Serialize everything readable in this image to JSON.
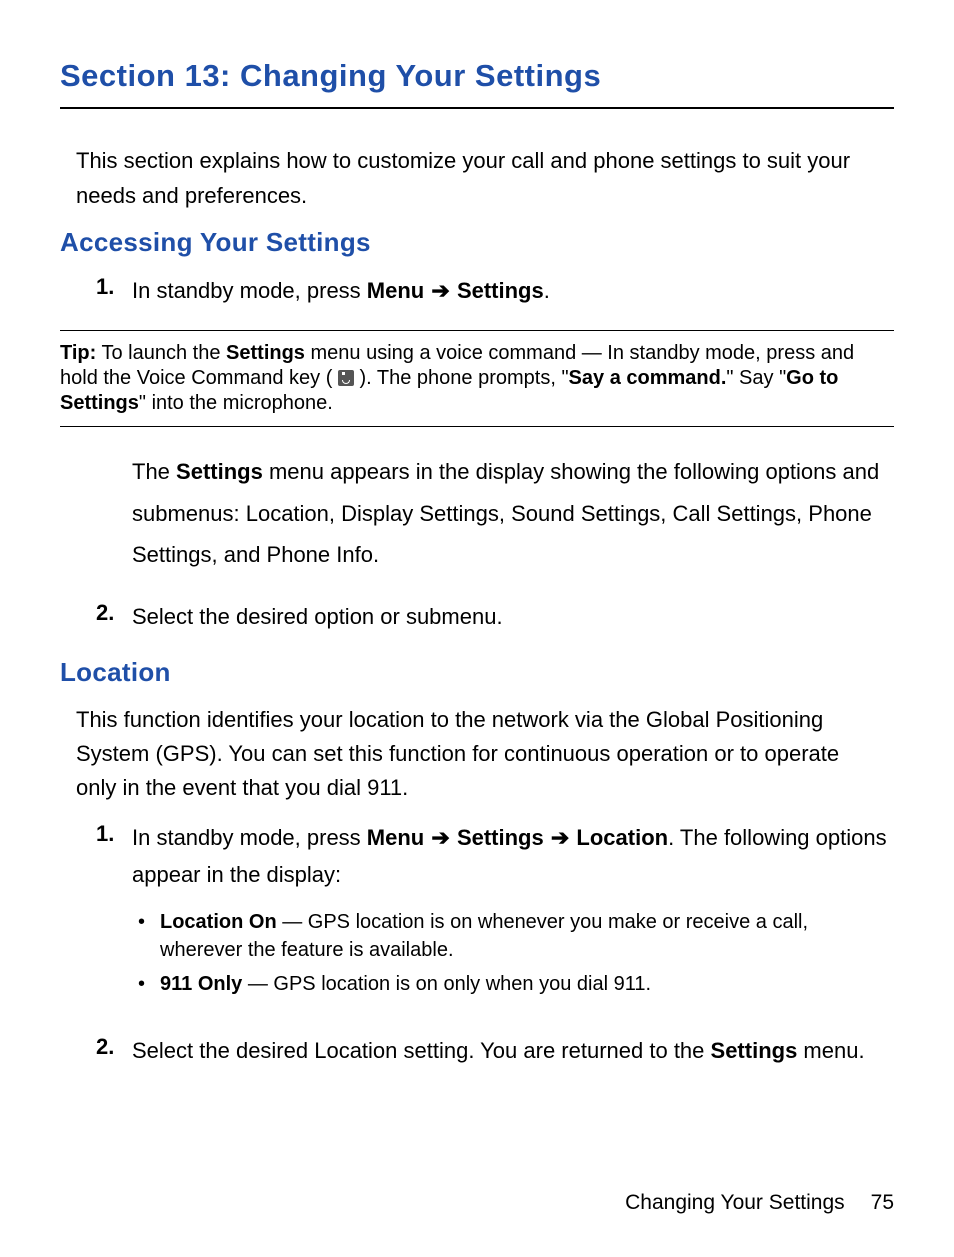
{
  "section_title": "Section 13: Changing Your Settings",
  "intro": "This section explains how to customize your call and phone settings to suit your needs and preferences.",
  "accessing": {
    "heading": "Accessing Your Settings",
    "steps": [
      {
        "num": "1.",
        "prefix": "In standby mode, press ",
        "menu": "Menu",
        "arrow": "➔",
        "settings": "Settings",
        "suffix": "."
      }
    ],
    "tip": {
      "label": "Tip:",
      "t1": " To launch the ",
      "b1": "Settings",
      "t2": " menu using a voice command — In standby mode, press and hold the Voice Command key ( ",
      "t3": " ). The phone prompts, \"",
      "b2": "Say a command.",
      "t4": "\" Say \"",
      "b3": "Go to Settings",
      "t5": "\" into the microphone."
    },
    "after_tip_1": "The ",
    "after_tip_b": "Settings",
    "after_tip_2": " menu appears in the display showing the following options and submenus: Location, Display Settings, Sound Settings, Call Settings, Phone Settings, and Phone Info.",
    "step2": {
      "num": "2.",
      "text": "Select the desired option or submenu."
    }
  },
  "location": {
    "heading": "Location",
    "intro": "This function identifies your location to the network via the Global Positioning System (GPS). You can set this function for continuous operation or to operate only in the event that you dial 911.",
    "step1": {
      "num": "1.",
      "prefix": "In standby mode, press ",
      "menu": "Menu",
      "a1": "➔",
      "settings": "Settings",
      "a2": "➔",
      "loc": "Location",
      "suffix": ". The following options appear in the display:"
    },
    "bullets": [
      {
        "b": "Location On",
        "rest": " — GPS location is on whenever you make or receive a call, wherever the feature is available."
      },
      {
        "b": "911 Only",
        "rest": " — GPS location is on only when you dial 911."
      }
    ],
    "step2": {
      "num": "2.",
      "t1": "Select the desired Location setting. You are returned to the ",
      "b": "Settings",
      "t2": " menu."
    }
  },
  "footer": {
    "label": "Changing Your Settings",
    "page": "75"
  }
}
